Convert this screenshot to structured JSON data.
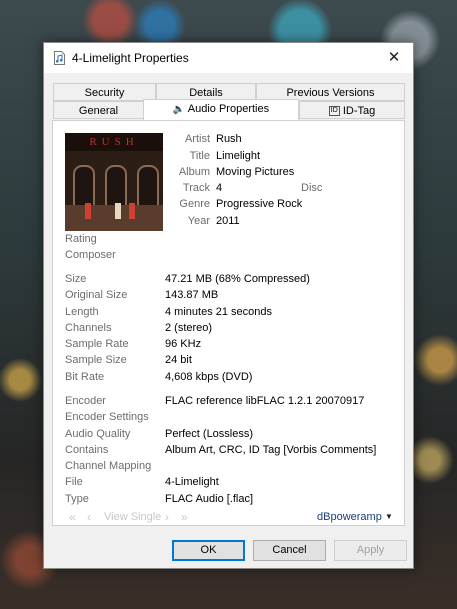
{
  "window": {
    "title": "4-Limelight Properties"
  },
  "tabs_back": [
    "Security",
    "Details",
    "Previous Versions"
  ],
  "tabs_front": [
    "General",
    "Audio Properties",
    "ID-Tag"
  ],
  "album_art": {
    "band_text": "RUSH"
  },
  "tag_fields": [
    {
      "label": "Artist",
      "value": "Rush"
    },
    {
      "label": "Title",
      "value": "Limelight"
    },
    {
      "label": "Album",
      "value": "Moving Pictures"
    },
    {
      "label": "Track",
      "value": "4"
    },
    {
      "label": "Genre",
      "value": "Progressive Rock"
    },
    {
      "label": "Year",
      "value": "2011"
    }
  ],
  "disc_label": "Disc",
  "extra_labels": [
    "Rating",
    "Composer"
  ],
  "file_info": [
    {
      "label": "Size",
      "value": "47.21 MB  (68% Compressed)"
    },
    {
      "label": "Original Size",
      "value": "143.87 MB"
    },
    {
      "label": "Length",
      "value": "4 minutes 21 seconds"
    },
    {
      "label": "Channels",
      "value": "2  (stereo)"
    },
    {
      "label": "Sample Rate",
      "value": "96 KHz"
    },
    {
      "label": "Sample Size",
      "value": "24 bit"
    },
    {
      "label": "Bit Rate",
      "value": "4,608 kbps  (DVD)"
    }
  ],
  "codec_info": [
    {
      "label": "Encoder",
      "value": "FLAC reference libFLAC 1.2.1 20070917"
    },
    {
      "label": "Encoder Settings",
      "value": ""
    },
    {
      "label": "Audio Quality",
      "value": "Perfect (Lossless)"
    },
    {
      "label": "Contains",
      "value": "Album Art, CRC, ID Tag [Vorbis Comments]"
    },
    {
      "label": "Channel Mapping",
      "value": ""
    },
    {
      "label": "File",
      "value": "4-Limelight"
    },
    {
      "label": "Type",
      "value": "FLAC Audio    [.flac]"
    }
  ],
  "nav": {
    "view_single": "View Single"
  },
  "brand": {
    "name": "dBpoweramp"
  },
  "buttons": {
    "ok": "OK",
    "cancel": "Cancel",
    "apply": "Apply"
  }
}
